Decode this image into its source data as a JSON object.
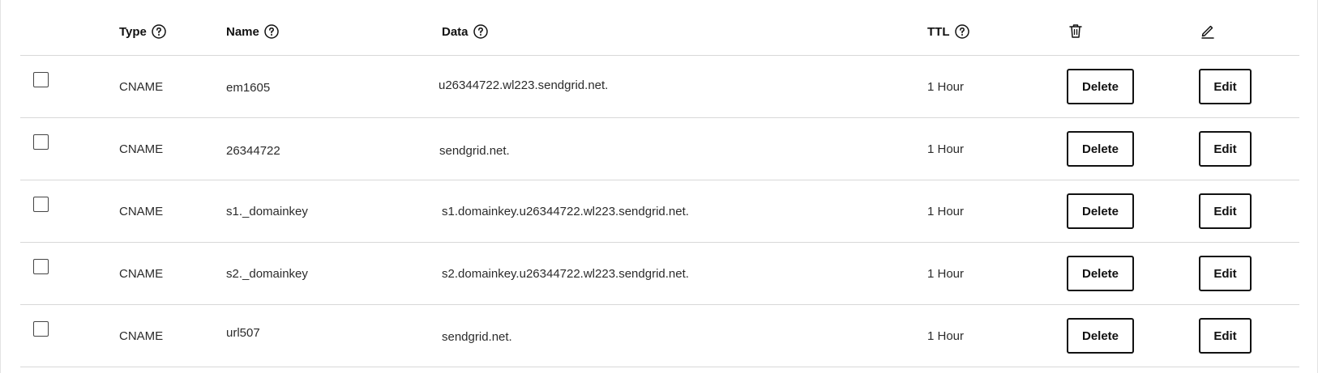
{
  "header": {
    "type_label": "Type",
    "name_label": "Name",
    "data_label": "Data",
    "ttl_label": "TTL",
    "delete_column_icon": "trash-icon",
    "edit_column_icon": "pencil-icon",
    "help_icon": "question-circle-icon"
  },
  "records": [
    {
      "type": "CNAME",
      "name": "em1605",
      "data": "u26344722.wl223.sendgrid.net.",
      "ttl": "1 Hour",
      "delete_label": "Delete",
      "edit_label": "Edit"
    },
    {
      "type": "CNAME",
      "name": "26344722",
      "data": "sendgrid.net.",
      "ttl": "1 Hour",
      "delete_label": "Delete",
      "edit_label": "Edit"
    },
    {
      "type": "CNAME",
      "name": "s1._domainkey",
      "data": "s1.domainkey.u26344722.wl223.sendgrid.net.",
      "ttl": "1 Hour",
      "delete_label": "Delete",
      "edit_label": "Edit"
    },
    {
      "type": "CNAME",
      "name": "s2._domainkey",
      "data": "s2.domainkey.u26344722.wl223.sendgrid.net.",
      "ttl": "1 Hour",
      "delete_label": "Delete",
      "edit_label": "Edit"
    },
    {
      "type": "CNAME",
      "name": "url507",
      "data": "sendgrid.net.",
      "ttl": "1 Hour",
      "delete_label": "Delete",
      "edit_label": "Edit"
    }
  ],
  "colors": {
    "border": "#d8d8d8",
    "text": "#2b2b2b",
    "button_border": "#111111"
  }
}
